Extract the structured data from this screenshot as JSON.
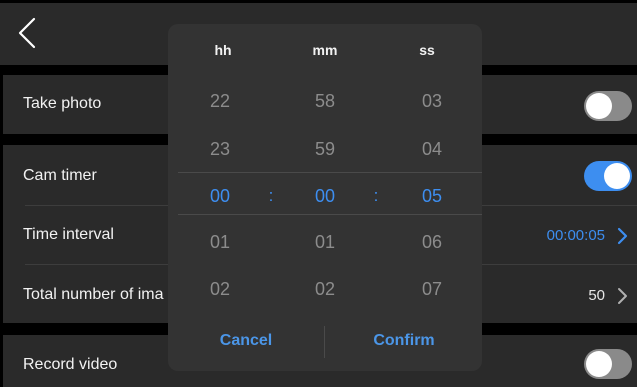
{
  "settings": {
    "take_photo": {
      "label": "Take photo",
      "enabled": false
    },
    "cam_timer": {
      "label": "Cam timer",
      "enabled": true
    },
    "time_interval": {
      "label": "Time interval",
      "value": "00:00:05"
    },
    "total_images": {
      "label": "Total number of ima",
      "value": "50"
    },
    "record_video": {
      "label": "Record video",
      "enabled": false
    }
  },
  "picker": {
    "headers": {
      "hours": "hh",
      "minutes": "mm",
      "seconds": "ss"
    },
    "hours": [
      "22",
      "23",
      "00",
      "01",
      "02"
    ],
    "minutes": [
      "58",
      "59",
      "00",
      "01",
      "02"
    ],
    "seconds": [
      "03",
      "04",
      "05",
      "06",
      "07"
    ],
    "separator": ":",
    "cancel_label": "Cancel",
    "confirm_label": "Confirm"
  },
  "icons": {
    "back": "chevron-left-icon",
    "row_arrow": "chevron-right-icon"
  },
  "colors": {
    "accent": "#3d8ef0",
    "toggle_off": "#8a8a8a",
    "panel": "#2a2a2a",
    "dialog": "#333333"
  }
}
